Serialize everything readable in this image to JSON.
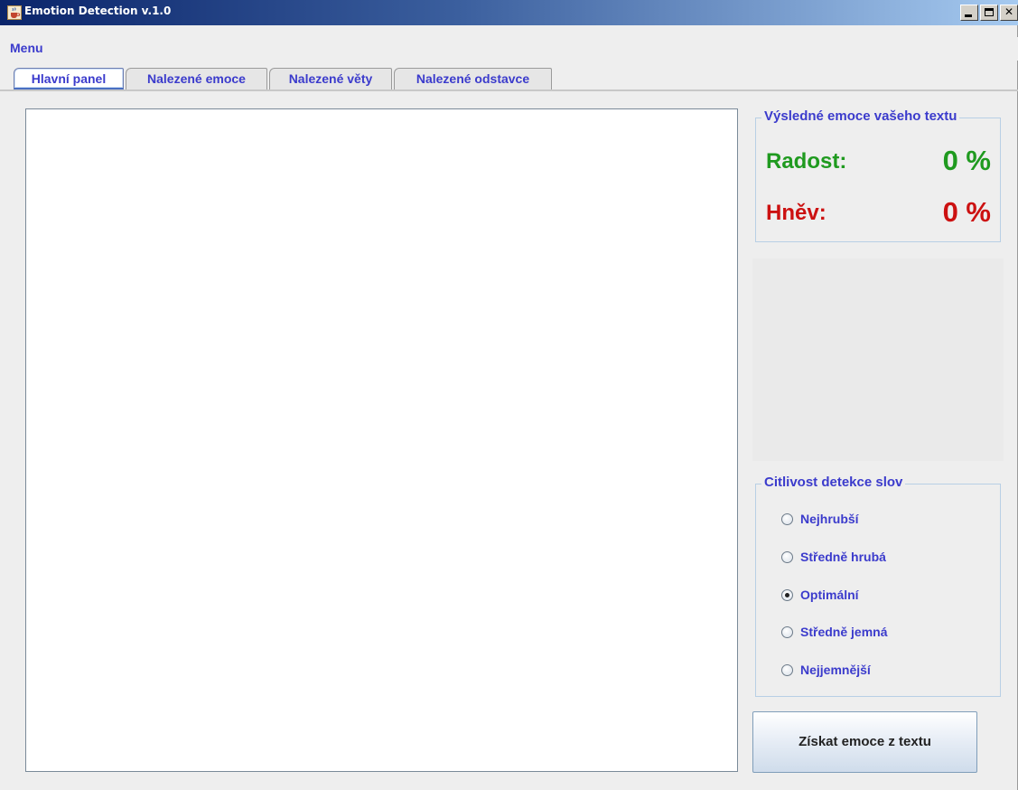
{
  "window": {
    "title": "Emotion Detection v.1.0",
    "icon": "java-cup-icon",
    "controls": [
      "minimize",
      "maximize",
      "close"
    ]
  },
  "menubar": {
    "items": [
      {
        "label": "Menu"
      }
    ]
  },
  "tabs": [
    {
      "label": "Hlavní panel",
      "active": true
    },
    {
      "label": "Nalezené emoce",
      "active": false
    },
    {
      "label": "Nalezené věty",
      "active": false
    },
    {
      "label": "Nalezené odstavce",
      "active": false
    }
  ],
  "main": {
    "input_text": ""
  },
  "results": {
    "title": "Výsledné emoce vašeho textu",
    "joy": {
      "label": "Radost:",
      "value": "0 %",
      "color": "#1f9a1f"
    },
    "anger": {
      "label": "Hněv:",
      "value": "0 %",
      "color": "#cc1111"
    }
  },
  "sensitivity": {
    "title": "Citlivost detekce slov",
    "options": [
      {
        "label": "Nejhrubší",
        "checked": false
      },
      {
        "label": "Středně hrubá",
        "checked": false
      },
      {
        "label": "Optimální",
        "checked": true
      },
      {
        "label": "Středně jemná",
        "checked": false
      },
      {
        "label": "Nejjemnější",
        "checked": false
      }
    ],
    "selected": "Optimální"
  },
  "actions": {
    "detect_label": "Získat emoce z textu"
  },
  "colors": {
    "accent_text": "#3b3bcc",
    "titlebar_start": "#0a246a",
    "titlebar_end": "#a6caf0"
  }
}
